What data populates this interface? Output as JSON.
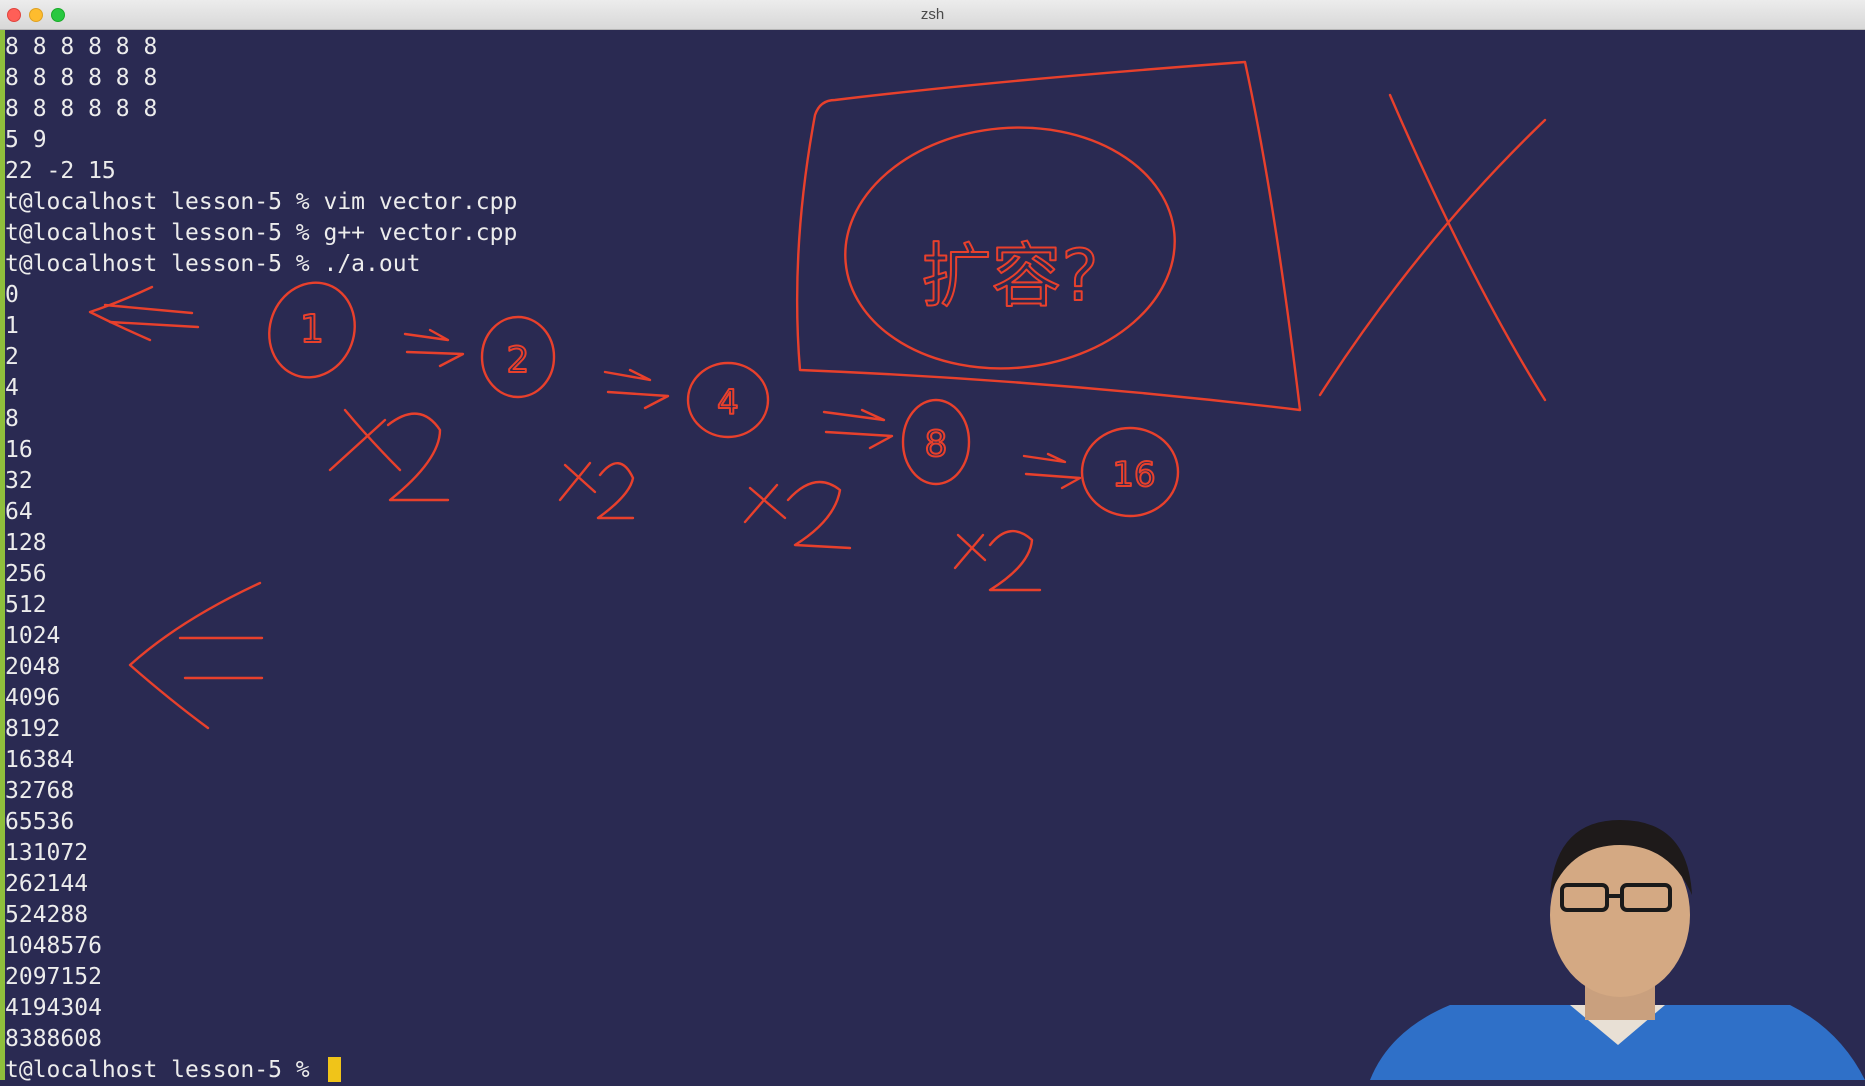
{
  "window": {
    "title": "zsh"
  },
  "terminal": {
    "lines": [
      "8 8 8 8 8 8",
      "8 8 8 8 8 8",
      "8 8 8 8 8 8",
      "5 9",
      "22 -2 15",
      "t@localhost lesson-5 % vim vector.cpp",
      "t@localhost lesson-5 % g++ vector.cpp",
      "t@localhost lesson-5 % ./a.out",
      "0",
      "1",
      "2",
      "4",
      "8",
      "16",
      "32",
      "64",
      "128",
      "256",
      "512",
      "1024",
      "2048",
      "4096",
      "8192",
      "16384",
      "32768",
      "65536",
      "131072",
      "262144",
      "524288",
      "1048576",
      "2097152",
      "4194304",
      "8388608"
    ],
    "prompt": "t@localhost lesson-5 % "
  },
  "annotations": {
    "circled_numbers": [
      "1",
      "2",
      "4",
      "8",
      "16"
    ],
    "multipliers": [
      "x2",
      "x2",
      "x2",
      "x2"
    ],
    "boxed_text": "扩容?",
    "color": "#e8402c"
  },
  "colors": {
    "terminal_bg": "#2a2a52",
    "terminal_fg": "#ececec",
    "cursor": "#f0c419",
    "left_accent": "#8fbf3c"
  }
}
